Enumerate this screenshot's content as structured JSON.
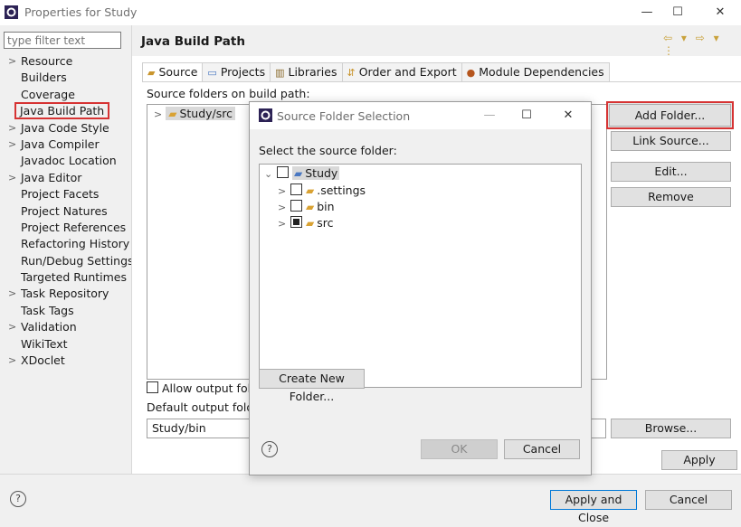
{
  "window": {
    "title": "Properties for Study",
    "minimize": "—",
    "maximize": "☐",
    "close": "✕"
  },
  "filter": {
    "placeholder": "type filter text"
  },
  "nav": {
    "items": [
      {
        "label": "Resource",
        "expandable": true
      },
      {
        "label": "Builders",
        "expandable": false
      },
      {
        "label": "Coverage",
        "expandable": false
      },
      {
        "label": "Java Build Path",
        "expandable": false,
        "selected": true
      },
      {
        "label": "Java Code Style",
        "expandable": true
      },
      {
        "label": "Java Compiler",
        "expandable": true
      },
      {
        "label": "Javadoc Location",
        "expandable": false
      },
      {
        "label": "Java Editor",
        "expandable": true
      },
      {
        "label": "Project Facets",
        "expandable": false
      },
      {
        "label": "Project Natures",
        "expandable": false
      },
      {
        "label": "Project References",
        "expandable": false
      },
      {
        "label": "Refactoring History",
        "expandable": false
      },
      {
        "label": "Run/Debug Settings",
        "expandable": false
      },
      {
        "label": "Targeted Runtimes",
        "expandable": false
      },
      {
        "label": "Task Repository",
        "expandable": true
      },
      {
        "label": "Task Tags",
        "expandable": false
      },
      {
        "label": "Validation",
        "expandable": true
      },
      {
        "label": "WikiText",
        "expandable": false
      },
      {
        "label": "XDoclet",
        "expandable": true
      }
    ]
  },
  "page": {
    "title": "Java Build Path",
    "nav_icons": "⇦ ▾ ⇨ ▾ ⋮"
  },
  "tabs": [
    {
      "label": "Source",
      "icon": "source-folder-icon",
      "active": true
    },
    {
      "label": "Projects",
      "icon": "projects-icon"
    },
    {
      "label": "Libraries",
      "icon": "libraries-icon"
    },
    {
      "label": "Order and Export",
      "icon": "order-export-icon"
    },
    {
      "label": "Module Dependencies",
      "icon": "module-icon"
    }
  ],
  "source": {
    "label": "Source folders on build path:",
    "items": [
      "Study/src"
    ],
    "allow_output_label": "Allow output fold",
    "default_output_label": "Default output folde",
    "output_value": "Study/bin"
  },
  "buttons": {
    "add_folder": "Add Folder...",
    "link_source": "Link Source...",
    "edit": "Edit...",
    "remove": "Remove",
    "browse": "Browse...",
    "apply": "Apply",
    "apply_close": "Apply and Close",
    "cancel": "Cancel"
  },
  "dialog": {
    "title": "Source Folder Selection",
    "prompt": "Select the source folder:",
    "tree": [
      {
        "label": "Study",
        "level": 0,
        "expanded": true,
        "checked": false,
        "selected": true
      },
      {
        "label": ".settings",
        "level": 1,
        "expanded": false,
        "checked": false
      },
      {
        "label": "bin",
        "level": 1,
        "expanded": false,
        "checked": false
      },
      {
        "label": "src",
        "level": 1,
        "expanded": false,
        "checked": "partial"
      }
    ],
    "create_folder": "Create New Folder...",
    "ok": "OK",
    "cancel": "Cancel"
  },
  "help_glyph": "?",
  "colors": {
    "highlight_red": "#d63333",
    "folder": "#d9a233",
    "focus_blue": "#0078d7"
  }
}
